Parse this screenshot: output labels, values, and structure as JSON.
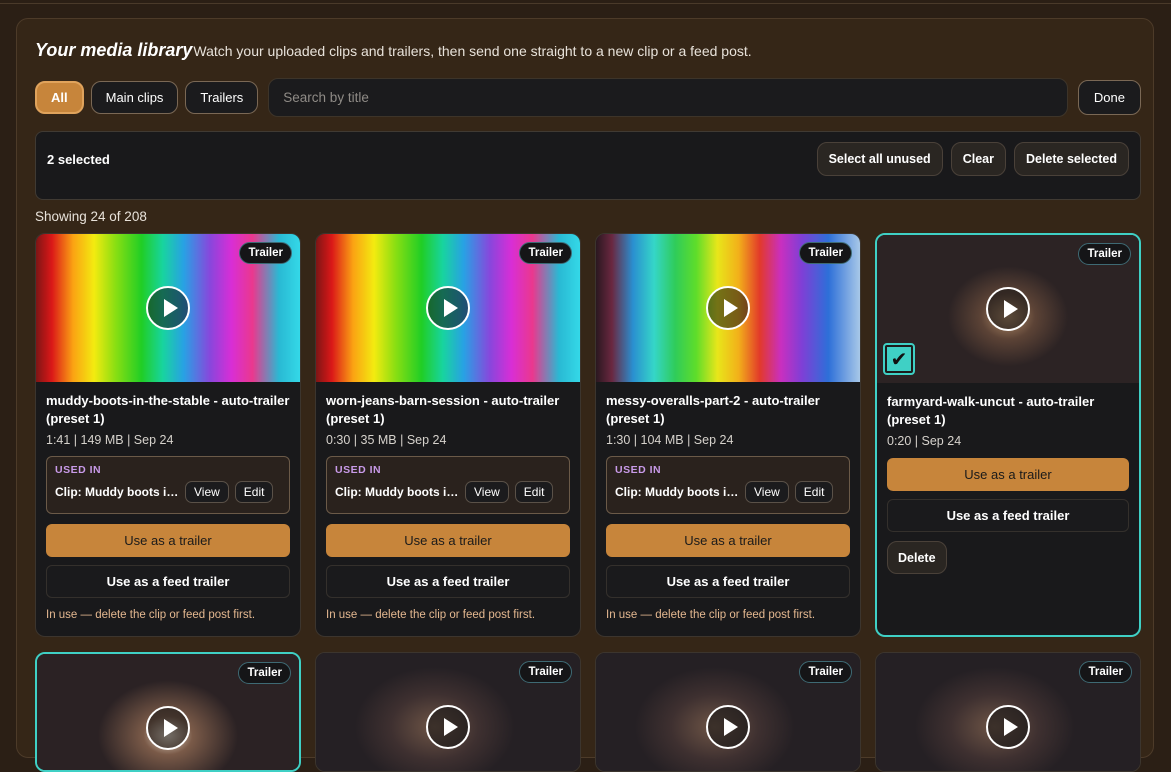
{
  "header": {
    "title": "Your media library",
    "subtitle": "Watch your uploaded clips and trailers, then send one straight to a new clip or a feed post."
  },
  "filters": {
    "chips": [
      "All",
      "Main clips",
      "Trailers"
    ],
    "active": "All",
    "search_placeholder": "Search by title",
    "done_label": "Done"
  },
  "selection": {
    "count_text": "2 selected",
    "select_all_unused": "Select all unused",
    "clear": "Clear",
    "delete_selected": "Delete selected"
  },
  "showing_text": "Showing 24 of 208",
  "cards": [
    {
      "badge": "Trailer",
      "title": "muddy-boots-in-the-stable - auto-trailer (preset 1)",
      "meta": "1:41 | 149 MB | Sep 24",
      "used_label": "USED IN",
      "used_clip": "Clip: Muddy boots in the stable",
      "view": "View",
      "edit": "Edit",
      "primary": "Use as a trailer",
      "secondary": "Use as a feed trailer",
      "note": "In use — delete the clip or feed post first."
    },
    {
      "badge": "Trailer",
      "title": "worn-jeans-barn-session - auto-trailer (preset 1)",
      "meta": "0:30 | 35 MB | Sep 24",
      "used_label": "USED IN",
      "used_clip": "Clip: Muddy boots in the stable",
      "view": "View",
      "edit": "Edit",
      "primary": "Use as a trailer",
      "secondary": "Use as a feed trailer",
      "note": "In use — delete the clip or feed post first."
    },
    {
      "badge": "Trailer",
      "title": "messy-overalls-part-2 - auto-trailer (preset 1)",
      "meta": "1:30 | 104 MB | Sep 24",
      "used_label": "USED IN",
      "used_clip": "Clip: Muddy boots in the stable",
      "view": "View",
      "edit": "Edit",
      "primary": "Use as a trailer",
      "secondary": "Use as a feed trailer",
      "note": "In use — delete the clip or feed post first."
    },
    {
      "badge": "Trailer",
      "title": "farmyard-walk-uncut - auto-trailer (preset 1)",
      "meta": "0:20 | Sep 24",
      "primary": "Use as a trailer",
      "secondary": "Use as a feed trailer",
      "delete": "Delete",
      "selected": true
    }
  ],
  "row2_badges": [
    "Trailer",
    "Trailer",
    "Trailer",
    "Trailer"
  ],
  "colors": {
    "accent": "#c7853b",
    "selected_outline": "#3fd0c5",
    "used_in_label": "#c89ae8",
    "background": "#2b1f15"
  }
}
